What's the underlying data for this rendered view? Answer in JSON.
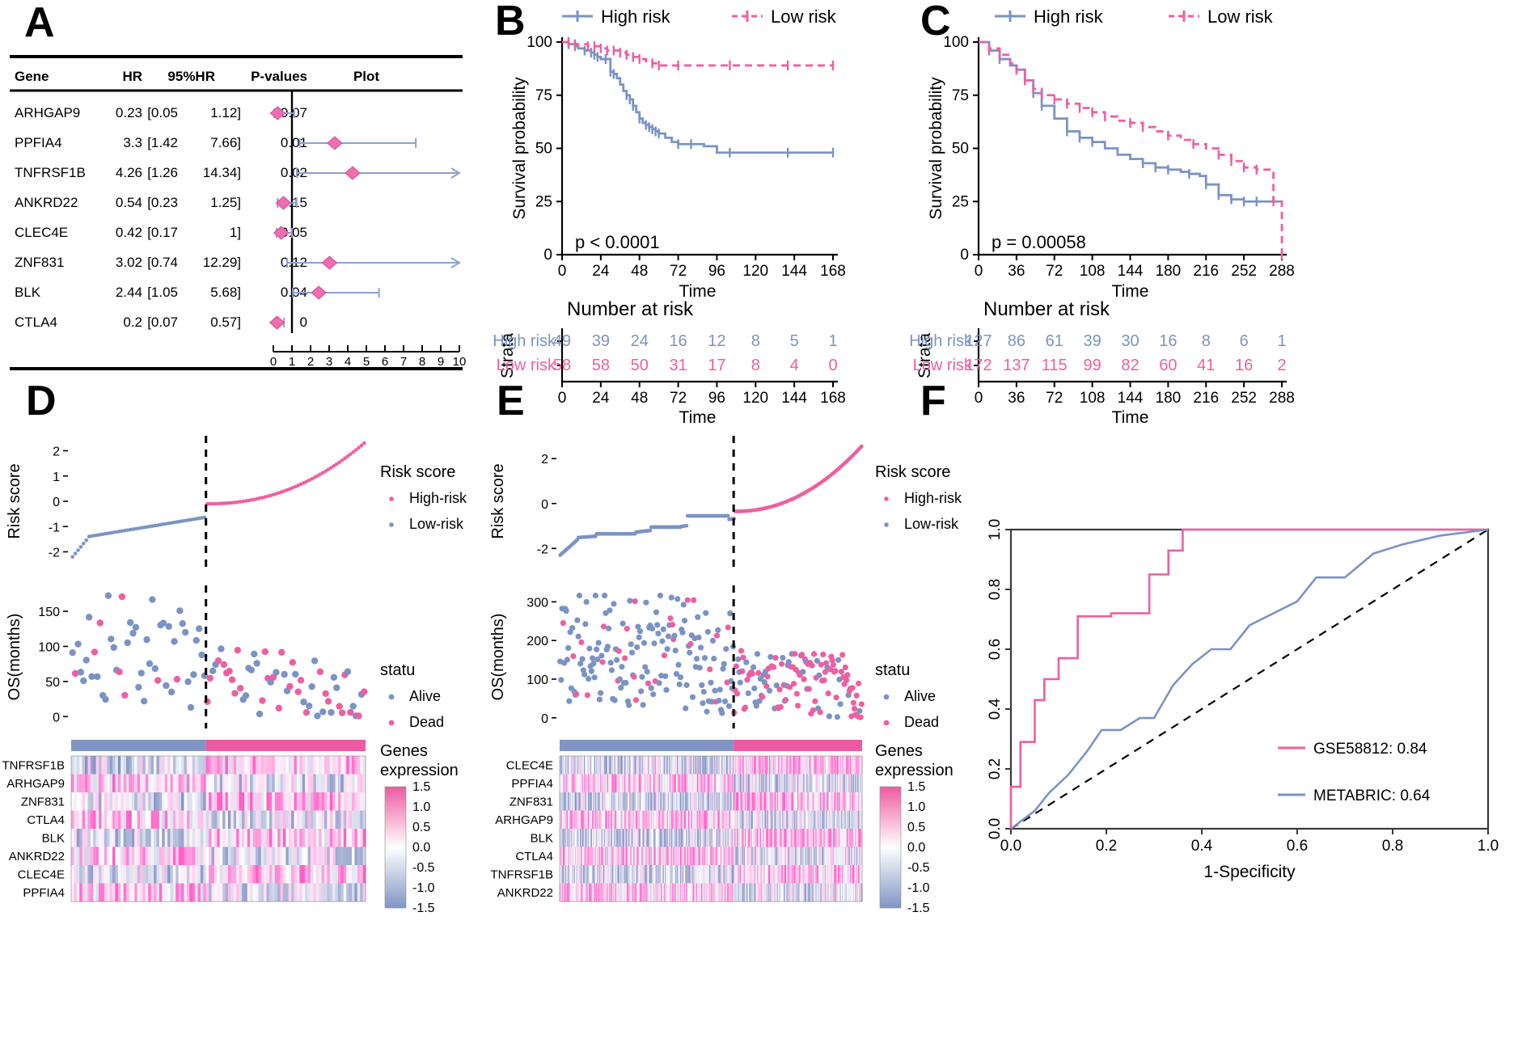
{
  "colors": {
    "high_risk_blue": "#7b93c4",
    "low_risk_pink": "#ef5fa0",
    "diamond_pink": "#ef6fae",
    "ci_blue": "#8ea0d4",
    "heat_pink": "#ec5ba0",
    "heat_blue": "#8095c4",
    "axis_black": "#000000"
  },
  "panels": {
    "a": "A",
    "b": "B",
    "c": "C",
    "d": "D",
    "e": "E",
    "f": "F"
  },
  "panelA": {
    "columns": [
      "Gene",
      "HR",
      "95%HR",
      "P-values",
      "Plot"
    ],
    "rows": [
      {
        "gene": "ARHGAP9",
        "hr": "0.23",
        "ci_low": "[0.05",
        "ci_high": "1.12]",
        "p": "0.07",
        "hr_val": 0.23,
        "lo": 0.05,
        "hi": 1.12,
        "arrow": false
      },
      {
        "gene": "PPFIA4",
        "hr": "3.3",
        "ci_low": "[1.42",
        "ci_high": "7.66]",
        "p": "0.01",
        "hr_val": 3.3,
        "lo": 1.42,
        "hi": 7.66,
        "arrow": false
      },
      {
        "gene": "TNFRSF1B",
        "hr": "4.26",
        "ci_low": "[1.26",
        "ci_high": "14.34]",
        "p": "0.02",
        "hr_val": 4.26,
        "lo": 1.26,
        "hi": 14.34,
        "arrow": true
      },
      {
        "gene": "ANKRD22",
        "hr": "0.54",
        "ci_low": "[0.23",
        "ci_high": "1.25]",
        "p": "0.15",
        "hr_val": 0.54,
        "lo": 0.23,
        "hi": 1.25,
        "arrow": false
      },
      {
        "gene": "CLEC4E",
        "hr": "0.42",
        "ci_low": "[0.17",
        "ci_high": "1]",
        "p": "0.05",
        "hr_val": 0.42,
        "lo": 0.17,
        "hi": 1.0,
        "arrow": false
      },
      {
        "gene": "ZNF831",
        "hr": "3.02",
        "ci_low": "[0.74",
        "ci_high": "12.29]",
        "p": "0.12",
        "hr_val": 3.02,
        "lo": 0.74,
        "hi": 12.29,
        "arrow": true
      },
      {
        "gene": "BLK",
        "hr": "2.44",
        "ci_low": "[1.05",
        "ci_high": "5.68]",
        "p": "0.04",
        "hr_val": 2.44,
        "lo": 1.05,
        "hi": 5.68,
        "arrow": false
      },
      {
        "gene": "CTLA4",
        "hr": "0.2",
        "ci_low": "[0.07",
        "ci_high": "0.57]",
        "p": "0",
        "hr_val": 0.2,
        "lo": 0.07,
        "hi": 0.57,
        "arrow": false
      }
    ],
    "axis_ticks": [
      "0",
      "1",
      "2",
      "3",
      "4",
      "5",
      "6",
      "7",
      "8",
      "9",
      "10"
    ],
    "axis_min": 0,
    "axis_max": 10,
    "reference_line": 1
  },
  "chart_data": [
    {
      "id": "panelB",
      "type": "line",
      "title": "",
      "xlabel": "Time",
      "ylabel": "Survival probability",
      "xlim": [
        0,
        168
      ],
      "ylim": [
        0,
        100
      ],
      "xticks": [
        "0",
        "24",
        "48",
        "72",
        "96",
        "120",
        "144",
        "168"
      ],
      "yticks": [
        "0",
        "25",
        "50",
        "75",
        "100"
      ],
      "pvalue": "p < 0.0001",
      "legend": [
        "High risk",
        "Low risk"
      ],
      "legend_position": "top",
      "risk_table_title": "Number at risk",
      "risk_table_axis_label": "Strata",
      "risk_rows": [
        {
          "label": "High risk",
          "values": [
            "49",
            "39",
            "24",
            "16",
            "12",
            "8",
            "5",
            "1"
          ]
        },
        {
          "label": "Low risk",
          "values": [
            "58",
            "58",
            "50",
            "31",
            "17",
            "8",
            "4",
            "0"
          ]
        }
      ],
      "series": [
        {
          "name": "High risk",
          "x": [
            0,
            4,
            8,
            10,
            14,
            18,
            20,
            22,
            24,
            27,
            30,
            32,
            34,
            36,
            38,
            40,
            42,
            44,
            46,
            48,
            50,
            52,
            54,
            56,
            58,
            60,
            64,
            68,
            72,
            80,
            88,
            96,
            104,
            120,
            140,
            168
          ],
          "y": [
            100,
            99,
            98,
            97,
            96,
            95,
            94,
            93,
            92,
            92,
            86,
            85,
            83,
            80,
            77,
            75,
            73,
            70,
            67,
            64,
            62,
            61,
            60,
            59,
            58,
            57,
            55,
            53,
            52,
            52,
            51,
            48,
            48,
            48,
            48,
            48
          ]
        },
        {
          "name": "Low risk",
          "x": [
            0,
            4,
            8,
            12,
            16,
            20,
            24,
            28,
            32,
            36,
            40,
            44,
            48,
            52,
            56,
            60,
            64,
            72,
            88,
            104,
            120,
            140,
            168
          ],
          "y": [
            100,
            100,
            99,
            99,
            98,
            98,
            97,
            96,
            96,
            95,
            94,
            93,
            92,
            91,
            90,
            89,
            89,
            89,
            89,
            89,
            89,
            89,
            89
          ]
        }
      ]
    },
    {
      "id": "panelC",
      "type": "line",
      "title": "",
      "xlabel": "Time",
      "ylabel": "Survival probability",
      "xlim": [
        0,
        288
      ],
      "ylim": [
        0,
        100
      ],
      "xticks": [
        "0",
        "36",
        "72",
        "108",
        "144",
        "180",
        "216",
        "252",
        "288"
      ],
      "yticks": [
        "0",
        "25",
        "50",
        "75",
        "100"
      ],
      "pvalue": "p = 0.00058",
      "legend": [
        "High risk",
        "Low risk"
      ],
      "legend_position": "top",
      "risk_table_title": "Number at risk",
      "risk_table_axis_label": "Strata",
      "risk_rows": [
        {
          "label": "High risk",
          "values": [
            "127",
            "86",
            "61",
            "39",
            "30",
            "16",
            "8",
            "6",
            "1"
          ]
        },
        {
          "label": "Low risk",
          "values": [
            "172",
            "137",
            "115",
            "99",
            "82",
            "60",
            "41",
            "16",
            "2"
          ]
        }
      ],
      "series": [
        {
          "name": "High risk",
          "x": [
            0,
            10,
            20,
            30,
            36,
            44,
            52,
            60,
            72,
            84,
            96,
            108,
            120,
            132,
            144,
            156,
            168,
            180,
            192,
            200,
            210,
            216,
            228,
            240,
            252,
            264,
            276,
            288
          ],
          "y": [
            100,
            96,
            92,
            89,
            87,
            82,
            76,
            70,
            64,
            58,
            55,
            53,
            50,
            47,
            45,
            43,
            41,
            40,
            39,
            38,
            37,
            33,
            28,
            26,
            25,
            25,
            25,
            25
          ]
        },
        {
          "name": "Low risk",
          "x": [
            0,
            10,
            20,
            30,
            36,
            44,
            52,
            60,
            72,
            84,
            96,
            108,
            120,
            132,
            144,
            156,
            168,
            180,
            192,
            204,
            216,
            228,
            240,
            252,
            264,
            272,
            280,
            288
          ],
          "y": [
            100,
            97,
            94,
            90,
            87,
            82,
            78,
            75,
            73,
            71,
            69,
            67,
            65,
            63,
            62,
            60,
            58,
            56,
            54,
            52,
            50,
            47,
            44,
            41,
            40,
            40,
            25,
            0
          ]
        }
      ]
    },
    {
      "id": "panelD_risk",
      "type": "scatter",
      "ylabel": "Risk score",
      "yticks": [
        "-2",
        "-1",
        "0",
        "1",
        "2"
      ],
      "ylim": [
        -2.4,
        2.4
      ],
      "n": 107,
      "cutoff_index": 49,
      "legend_title": "Risk score",
      "legend": [
        "High-risk",
        "Low-risk"
      ]
    },
    {
      "id": "panelD_os",
      "type": "scatter",
      "ylabel": "OS(months)",
      "yticks": [
        "0",
        "50",
        "100",
        "150"
      ],
      "ylim": [
        -10,
        180
      ],
      "legend_title": "statu",
      "legend": [
        "Alive",
        "Dead"
      ]
    },
    {
      "id": "panelD_heat",
      "type": "heatmap",
      "genes": [
        "TNFRSF1B",
        "ARHGAP9",
        "ZNF831",
        "CTLA4",
        "BLK",
        "ANKRD22",
        "CLEC4E",
        "PPFIA4"
      ],
      "legend_title": "Genes expression",
      "scale_ticks": [
        "1.5",
        "1.0",
        "0.5",
        "0.0",
        "-0.5",
        "-1.0",
        "-1.5"
      ]
    },
    {
      "id": "panelE_risk",
      "type": "scatter",
      "ylabel": "Risk score",
      "yticks": [
        "-2",
        "0",
        "2"
      ],
      "ylim": [
        -2.6,
        2.8
      ],
      "n": 299,
      "cutoff_index": 172,
      "legend_title": "Risk score",
      "legend": [
        "High-risk",
        "Low-risk"
      ]
    },
    {
      "id": "panelE_os",
      "type": "scatter",
      "ylabel": "OS(months)",
      "yticks": [
        "0",
        "100",
        "200",
        "300"
      ],
      "ylim": [
        -15,
        330
      ],
      "legend_title": "statu",
      "legend": [
        "Alive",
        "Dead"
      ]
    },
    {
      "id": "panelE_heat",
      "type": "heatmap",
      "genes": [
        "CLEC4E",
        "PPFIA4",
        "ZNF831",
        "ARHGAP9",
        "BLK",
        "CTLA4",
        "TNFRSF1B",
        "ANKRD22"
      ],
      "legend_title": "Genes expression",
      "scale_ticks": [
        "1.5",
        "1.0",
        "0.5",
        "0.0",
        "-0.5",
        "-1.0",
        "-1.5"
      ]
    },
    {
      "id": "panelF",
      "type": "line",
      "xlabel": "1-Specificity",
      "ylabel": "",
      "xlim": [
        0,
        1
      ],
      "ylim": [
        0,
        1
      ],
      "xticks": [
        "0.0",
        "0.2",
        "0.4",
        "0.6",
        "0.8",
        "1.0"
      ],
      "yticks": [
        "0.0",
        "0.2",
        "0.4",
        "0.6",
        "0.8",
        "1.0"
      ],
      "legend": [
        {
          "label": "GSE58812: 0.84",
          "color": "#ef5fa0"
        },
        {
          "label": "METABRIC: 0.64",
          "color": "#7b93c4"
        }
      ],
      "series": [
        {
          "name": "GSE58812",
          "auc": 0.84,
          "x": [
            0.0,
            0.0,
            0.02,
            0.02,
            0.05,
            0.05,
            0.07,
            0.07,
            0.1,
            0.1,
            0.14,
            0.14,
            0.21,
            0.21,
            0.29,
            0.29,
            0.33,
            0.33,
            0.36,
            0.36,
            1.0
          ],
          "y": [
            0.0,
            0.14,
            0.14,
            0.29,
            0.29,
            0.43,
            0.43,
            0.5,
            0.5,
            0.57,
            0.57,
            0.71,
            0.71,
            0.72,
            0.72,
            0.85,
            0.85,
            0.93,
            0.93,
            1.0,
            1.0
          ]
        },
        {
          "name": "METABRIC",
          "auc": 0.64,
          "x": [
            0.0,
            0.05,
            0.08,
            0.12,
            0.16,
            0.19,
            0.23,
            0.27,
            0.3,
            0.34,
            0.38,
            0.42,
            0.46,
            0.5,
            0.55,
            0.6,
            0.64,
            0.7,
            0.76,
            0.82,
            0.9,
            1.0
          ],
          "y": [
            0.0,
            0.06,
            0.12,
            0.18,
            0.26,
            0.33,
            0.33,
            0.37,
            0.37,
            0.48,
            0.55,
            0.6,
            0.6,
            0.68,
            0.72,
            0.76,
            0.84,
            0.84,
            0.92,
            0.95,
            0.98,
            1.0
          ]
        }
      ],
      "diagonal": true
    }
  ]
}
